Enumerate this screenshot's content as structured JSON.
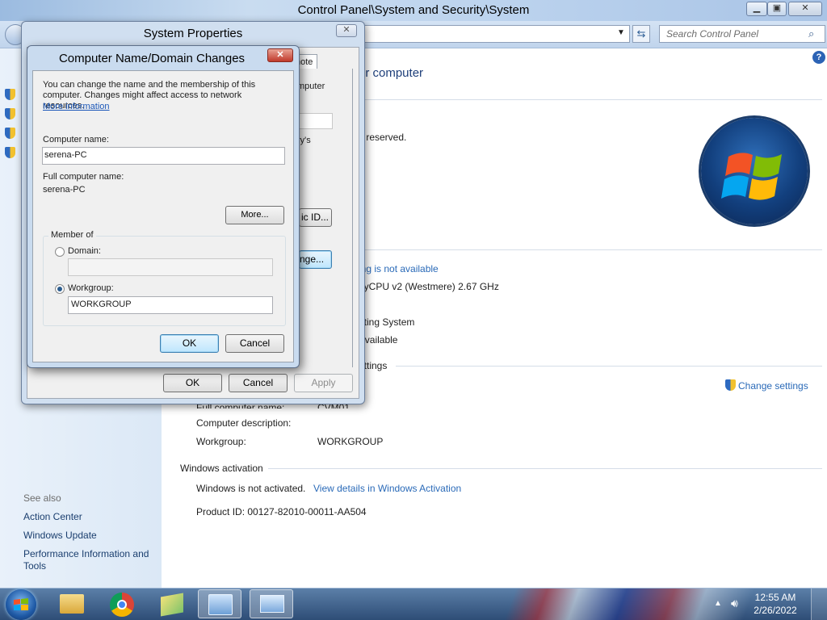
{
  "window": {
    "title": "Control Panel\\System and Security\\System",
    "search_placeholder": "Search Control Panel",
    "help_icon": "?"
  },
  "left_pane": {
    "see_also": "See also",
    "links": [
      "Action Center",
      "Windows Update",
      "Performance Information and Tools"
    ]
  },
  "main": {
    "heading_partial": "ur computer",
    "rights_partial": "s reserved.",
    "rating_partial": "ing is not available",
    "processor_partial": "nyCPU v2 (Westmere)   2.67 GHz",
    "os_partial": "ating System",
    "touch_partial": "Available",
    "settings_section_partial": "ettings",
    "change_settings": "Change settings",
    "computer_name_label_partial": "Full computer name:",
    "computer_name_value_partial": "CVM01",
    "computer_description_label": "Computer description:",
    "workgroup_label": "Workgroup:",
    "workgroup_value": "WORKGROUP",
    "activation_section": "Windows activation",
    "activation_status": "Windows is not activated.",
    "activation_link": "View details in Windows Activation",
    "product_id": "Product ID: 00127-82010-00011-AA504"
  },
  "system_properties": {
    "title": "System Properties",
    "tab_partial": "note",
    "text_partial_1": "mputer",
    "text_partial_2": "ry's",
    "btn_id_partial": "ic ID...",
    "btn_change_partial": "nge...",
    "ok": "OK",
    "cancel": "Cancel",
    "apply": "Apply"
  },
  "computer_name_dialog": {
    "title": "Computer Name/Domain Changes",
    "description": "You can change the name and the membership of this computer. Changes might affect access to network resources.",
    "more_info": "More information",
    "computer_name_label": "Computer name:",
    "computer_name_value": "serena-PC",
    "full_name_label": "Full computer name:",
    "full_name_value": "serena-PC",
    "more_button": "More...",
    "member_of": "Member of",
    "domain_label": "Domain:",
    "domain_value": "",
    "workgroup_label": "Workgroup:",
    "workgroup_value": "WORKGROUP",
    "selected": "workgroup",
    "ok": "OK",
    "cancel": "Cancel"
  },
  "taskbar": {
    "time": "12:55 AM",
    "date": "2/26/2022"
  }
}
